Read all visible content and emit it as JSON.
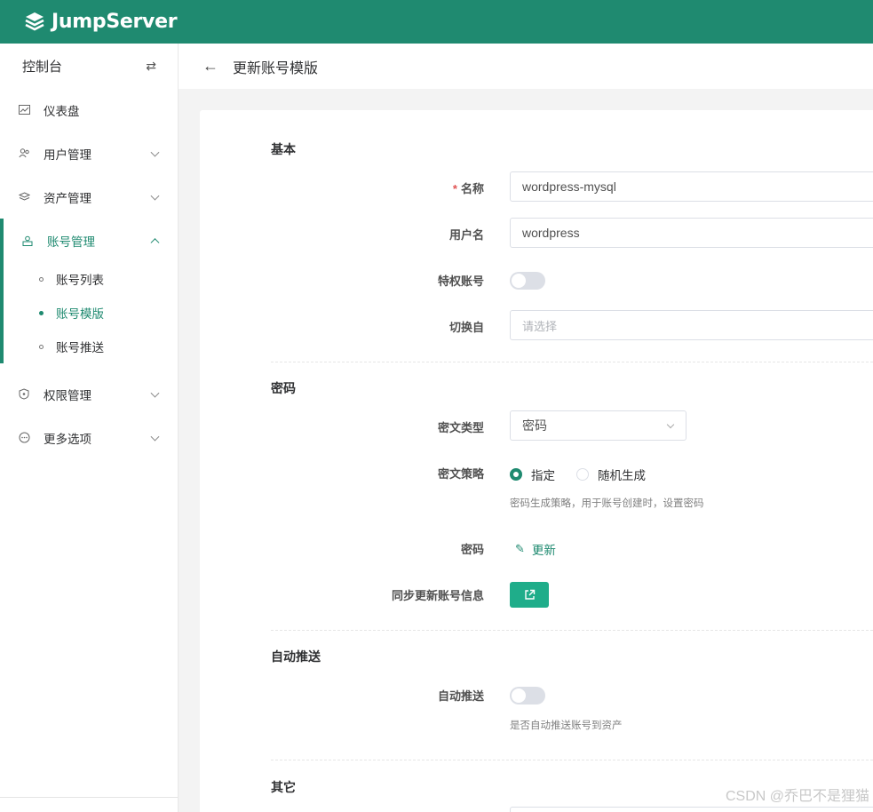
{
  "brand": {
    "name": "JumpServer"
  },
  "sidebar": {
    "title": "控制台",
    "swap_icon": "⇄",
    "items": [
      {
        "label": "仪表盘",
        "icon": "dashboard-icon"
      },
      {
        "label": "用户管理",
        "icon": "users-icon"
      },
      {
        "label": "资产管理",
        "icon": "layers-icon"
      },
      {
        "label": "账号管理",
        "icon": "account-icon",
        "expanded": true,
        "children": [
          {
            "label": "账号列表"
          },
          {
            "label": "账号模版",
            "active": true
          },
          {
            "label": "账号推送"
          }
        ]
      },
      {
        "label": "权限管理",
        "icon": "shield-icon"
      },
      {
        "label": "更多选项",
        "icon": "more-icon"
      }
    ]
  },
  "header": {
    "title": "更新账号模版"
  },
  "form": {
    "basic": {
      "title": "基本",
      "name_label": "名称",
      "name_value": "wordpress-mysql",
      "username_label": "用户名",
      "username_value": "wordpress",
      "privileged_label": "特权账号",
      "privileged_on": false,
      "su_from_label": "切换自",
      "su_from_placeholder": "请选择"
    },
    "secret": {
      "title": "密码",
      "type_label": "密文类型",
      "type_value": "密码",
      "strategy_label": "密文策略",
      "strategy_options": [
        "指定",
        "随机生成"
      ],
      "strategy_selected": "指定",
      "strategy_help": "密码生成策略，用于账号创建时，设置密码",
      "password_label": "密码",
      "password_action": "更新",
      "sync_label": "同步更新账号信息"
    },
    "auto_push": {
      "title": "自动推送",
      "label": "自动推送",
      "on": false,
      "help": "是否自动推送账号到资产"
    },
    "other": {
      "title": "其它"
    }
  },
  "colors": {
    "brand": "#1f8a70",
    "button": "#1fad8a"
  },
  "watermark": "CSDN @乔巴不是狸猫"
}
